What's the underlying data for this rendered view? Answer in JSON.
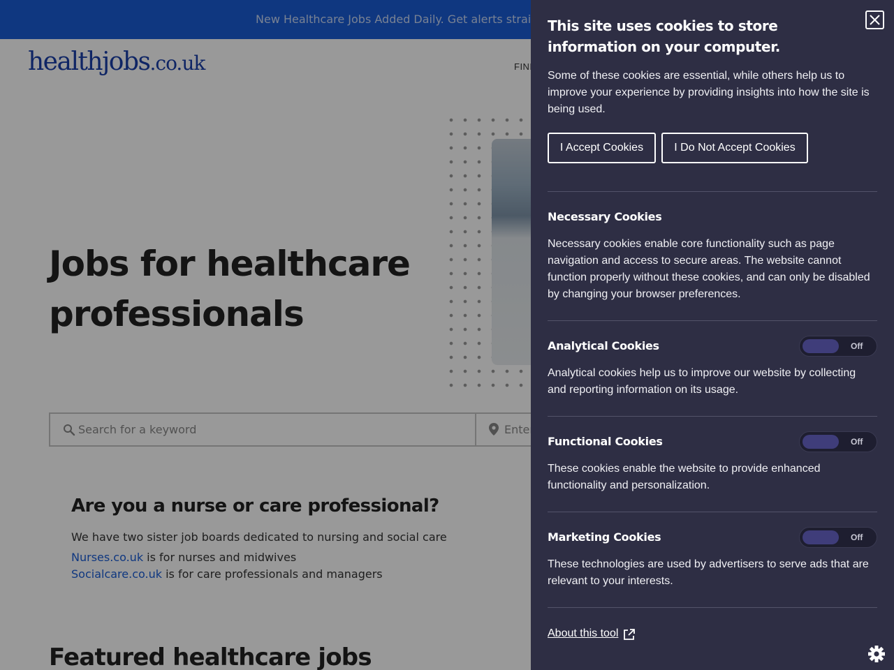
{
  "topbar": {
    "text": "New Healthcare Jobs Added Daily. Get alerts strai"
  },
  "header": {
    "logo_main": "healthjobs",
    "logo_tld": ".co.uk",
    "nav_find": "FIND"
  },
  "hero": {
    "title": "Jobs for healthcare professionals"
  },
  "search": {
    "keyword_placeholder": "Search for a keyword",
    "location_placeholder": "Enter"
  },
  "sister": {
    "title": "Are you a nurse or care professional?",
    "intro": "We have two sister job boards dedicated to nursing and social care",
    "nurses_link": "Nurses.co.uk",
    "nurses_text": " is for nurses and midwives",
    "social_link": "Socialcare.co.uk",
    "social_text": " is for care professionals and managers"
  },
  "featured": {
    "title": "Featured healthcare jobs"
  },
  "cookie": {
    "title": "This site uses cookies to store information on your computer.",
    "intro": "Some of these cookies are essential, while others help us to improve your experience by providing insights into how the site is being used.",
    "accept_label": "I Accept Cookies",
    "decline_label": "I Do Not Accept Cookies",
    "sections": [
      {
        "title": "Necessary Cookies",
        "text": "Necessary cookies enable core functionality such as page navigation and access to secure areas. The website cannot function properly without these cookies, and can only be disabled by changing your browser preferences."
      },
      {
        "title": "Analytical Cookies",
        "toggle": "Off",
        "text": "Analytical cookies help us to improve our website by collecting and reporting information on its usage."
      },
      {
        "title": "Functional Cookies",
        "toggle": "Off",
        "text": "These cookies enable the website to provide enhanced functionality and personalization."
      },
      {
        "title": "Marketing Cookies",
        "toggle": "Off",
        "text": "These technologies are used by advertisers to serve ads that are relevant to your interests."
      }
    ],
    "about_label": "About this tool"
  },
  "colors": {
    "brand_blue": "#1a5dd6",
    "panel_bg": "#2e2e44",
    "toggle_knob": "#3f3d7a"
  }
}
